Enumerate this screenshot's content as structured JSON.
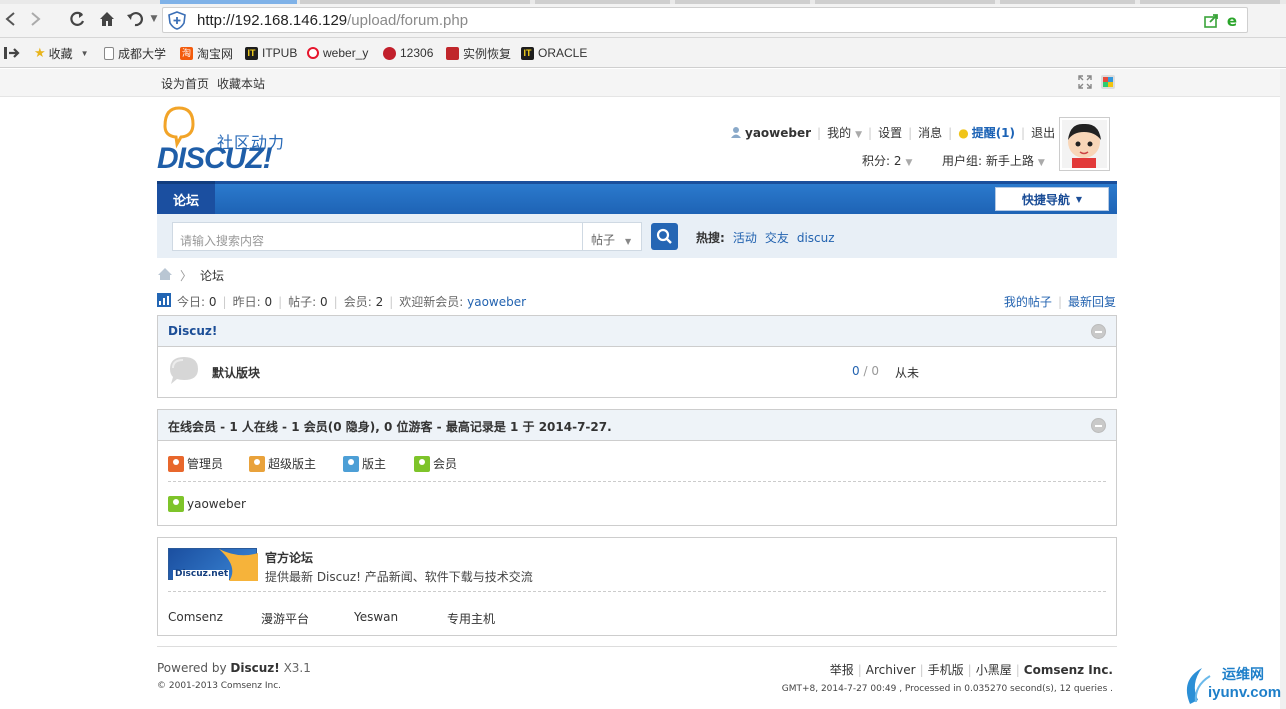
{
  "browser": {
    "url_host": "http://192.168.146.129",
    "url_path": "/upload/forum.php",
    "bookmarks": [
      "收藏",
      "成都大学",
      "淘宝网",
      "ITPUB",
      "weber_y",
      "12306",
      "实例恢复",
      "ORACLE"
    ]
  },
  "toolbar": {
    "set_home": "设为首页",
    "favorite": "收藏本站"
  },
  "logo": {
    "tagline": "社区动力",
    "word": "DISCUZ!"
  },
  "user_menu": {
    "username": "yaoweber",
    "my": "我的",
    "settings": "设置",
    "messages": "消息",
    "reminders": "提醒(1)",
    "logout": "退出",
    "credits": "积分: 2",
    "usergroup": "用户组: 新手上路"
  },
  "nav": {
    "forum": "论坛",
    "quick_nav": "快捷导航"
  },
  "search": {
    "placeholder": "请输入搜索内容",
    "type": "帖子",
    "hot_label": "热搜:",
    "hot_terms": [
      "活动",
      "交友",
      "discuz"
    ]
  },
  "breadcrumb": {
    "current": "论坛"
  },
  "stats": {
    "today_label": "今日:",
    "today": "0",
    "yesterday_label": "昨日:",
    "yesterday": "0",
    "posts_label": "帖子:",
    "posts": "0",
    "members_label": "会员:",
    "members": "2",
    "welcome_label": "欢迎新会员:",
    "newest_member": "yaoweber",
    "my_posts": "我的帖子",
    "latest_replies": "最新回复"
  },
  "category": {
    "title": "Discuz!",
    "forum_name": "默认版块",
    "threads": "0",
    "slash": "/",
    "replies": "0",
    "last_post": "从未"
  },
  "online": {
    "title": "在线会员 - 1 人在线 - 1 会员(0 隐身), 0 位游客 - 最高记录是 1 于 2014-7-27.",
    "legend": [
      "管理员",
      "超级版主",
      "版主",
      "会员"
    ],
    "legend_colors": [
      "#e8672c",
      "#e9a23b",
      "#4d9fd6",
      "#7ec42a"
    ],
    "members": [
      "yaoweber"
    ]
  },
  "links": {
    "banner_text": "Discuz.net",
    "official_title": "官方论坛",
    "official_desc": "提供最新 Discuz! 产品新闻、软件下载与技术交流",
    "text_links": [
      "Comsenz",
      "漫游平台",
      "Yeswan",
      "专用主机"
    ]
  },
  "footer": {
    "powered_prefix": "Powered by",
    "powered_brand": "Discuz!",
    "version": "X3.1",
    "copyright": "© 2001-2013 Comsenz Inc.",
    "links": [
      "举报",
      "Archiver",
      "手机版",
      "小黑屋"
    ],
    "company": "Comsenz Inc.",
    "debug": "GMT+8, 2014-7-27 00:49 , Processed in 0.035270 second(s), 12 queries ."
  },
  "watermark": {
    "text_cn": "运维网",
    "text_en": "iyunv.com"
  }
}
